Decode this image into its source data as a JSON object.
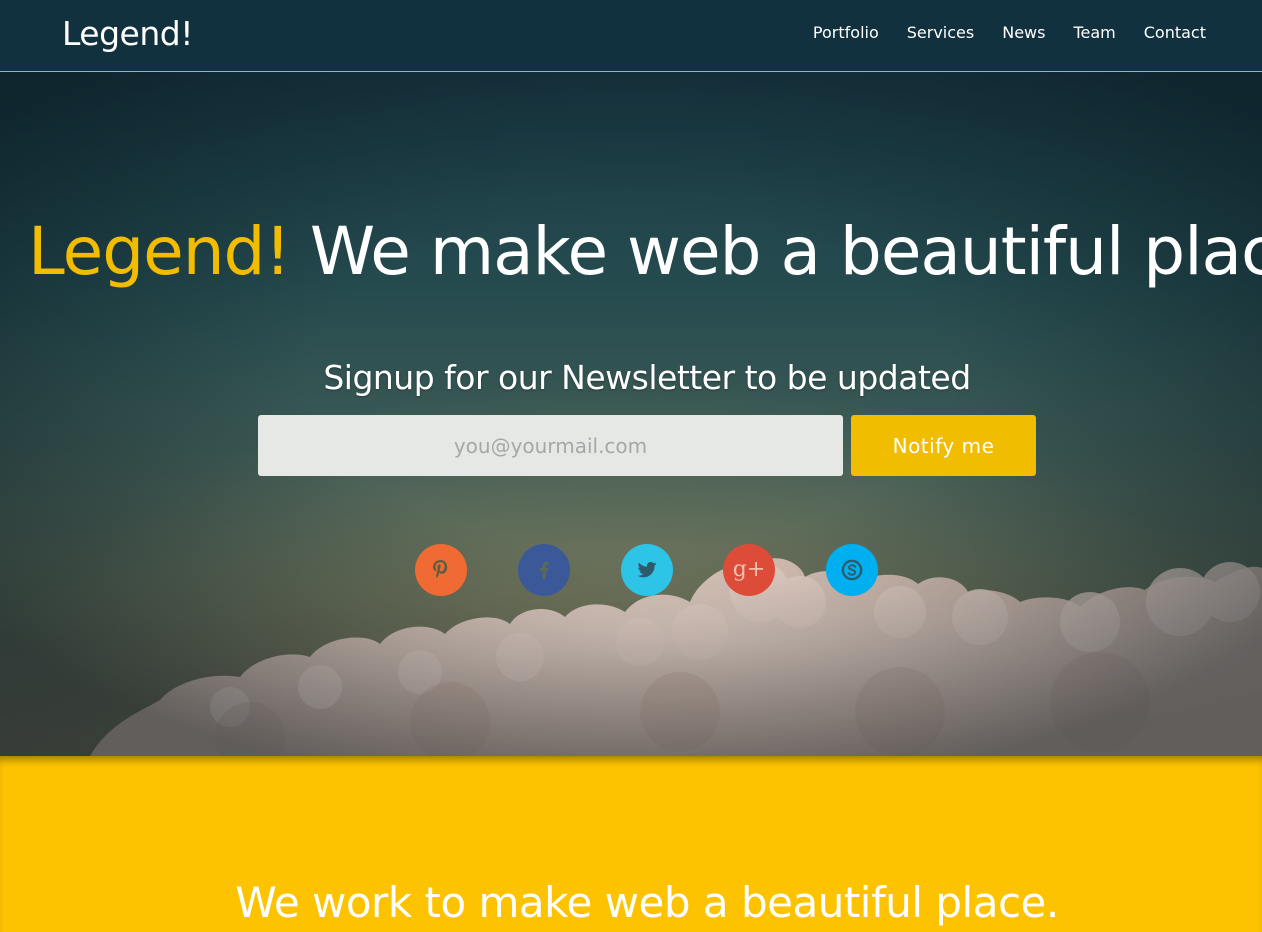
{
  "navbar": {
    "brand": "Legend!",
    "links": [
      "Portfolio",
      "Services",
      "News",
      "Team",
      "Contact"
    ]
  },
  "hero": {
    "title_accent": "Legend!",
    "title_rest": " We make web a beautiful place.",
    "newsletter_heading": "Signup for our Newsletter to be updated",
    "email_placeholder": "you@yourmail.com",
    "notify_label": "Notify me",
    "social": [
      {
        "name": "pinterest-icon",
        "color": "#ef6b33"
      },
      {
        "name": "facebook-icon",
        "color": "#3b5998"
      },
      {
        "name": "twitter-icon",
        "color": "#2ec4e8"
      },
      {
        "name": "google-plus-icon",
        "color": "#dd4b39"
      },
      {
        "name": "skype-icon",
        "color": "#00aff0"
      }
    ]
  },
  "about": {
    "title": "We work to make web a beautiful place."
  },
  "colors": {
    "navbar_bg": "#11313f",
    "accent_yellow": "#f2bd00",
    "section_yellow": "#fdc300"
  }
}
